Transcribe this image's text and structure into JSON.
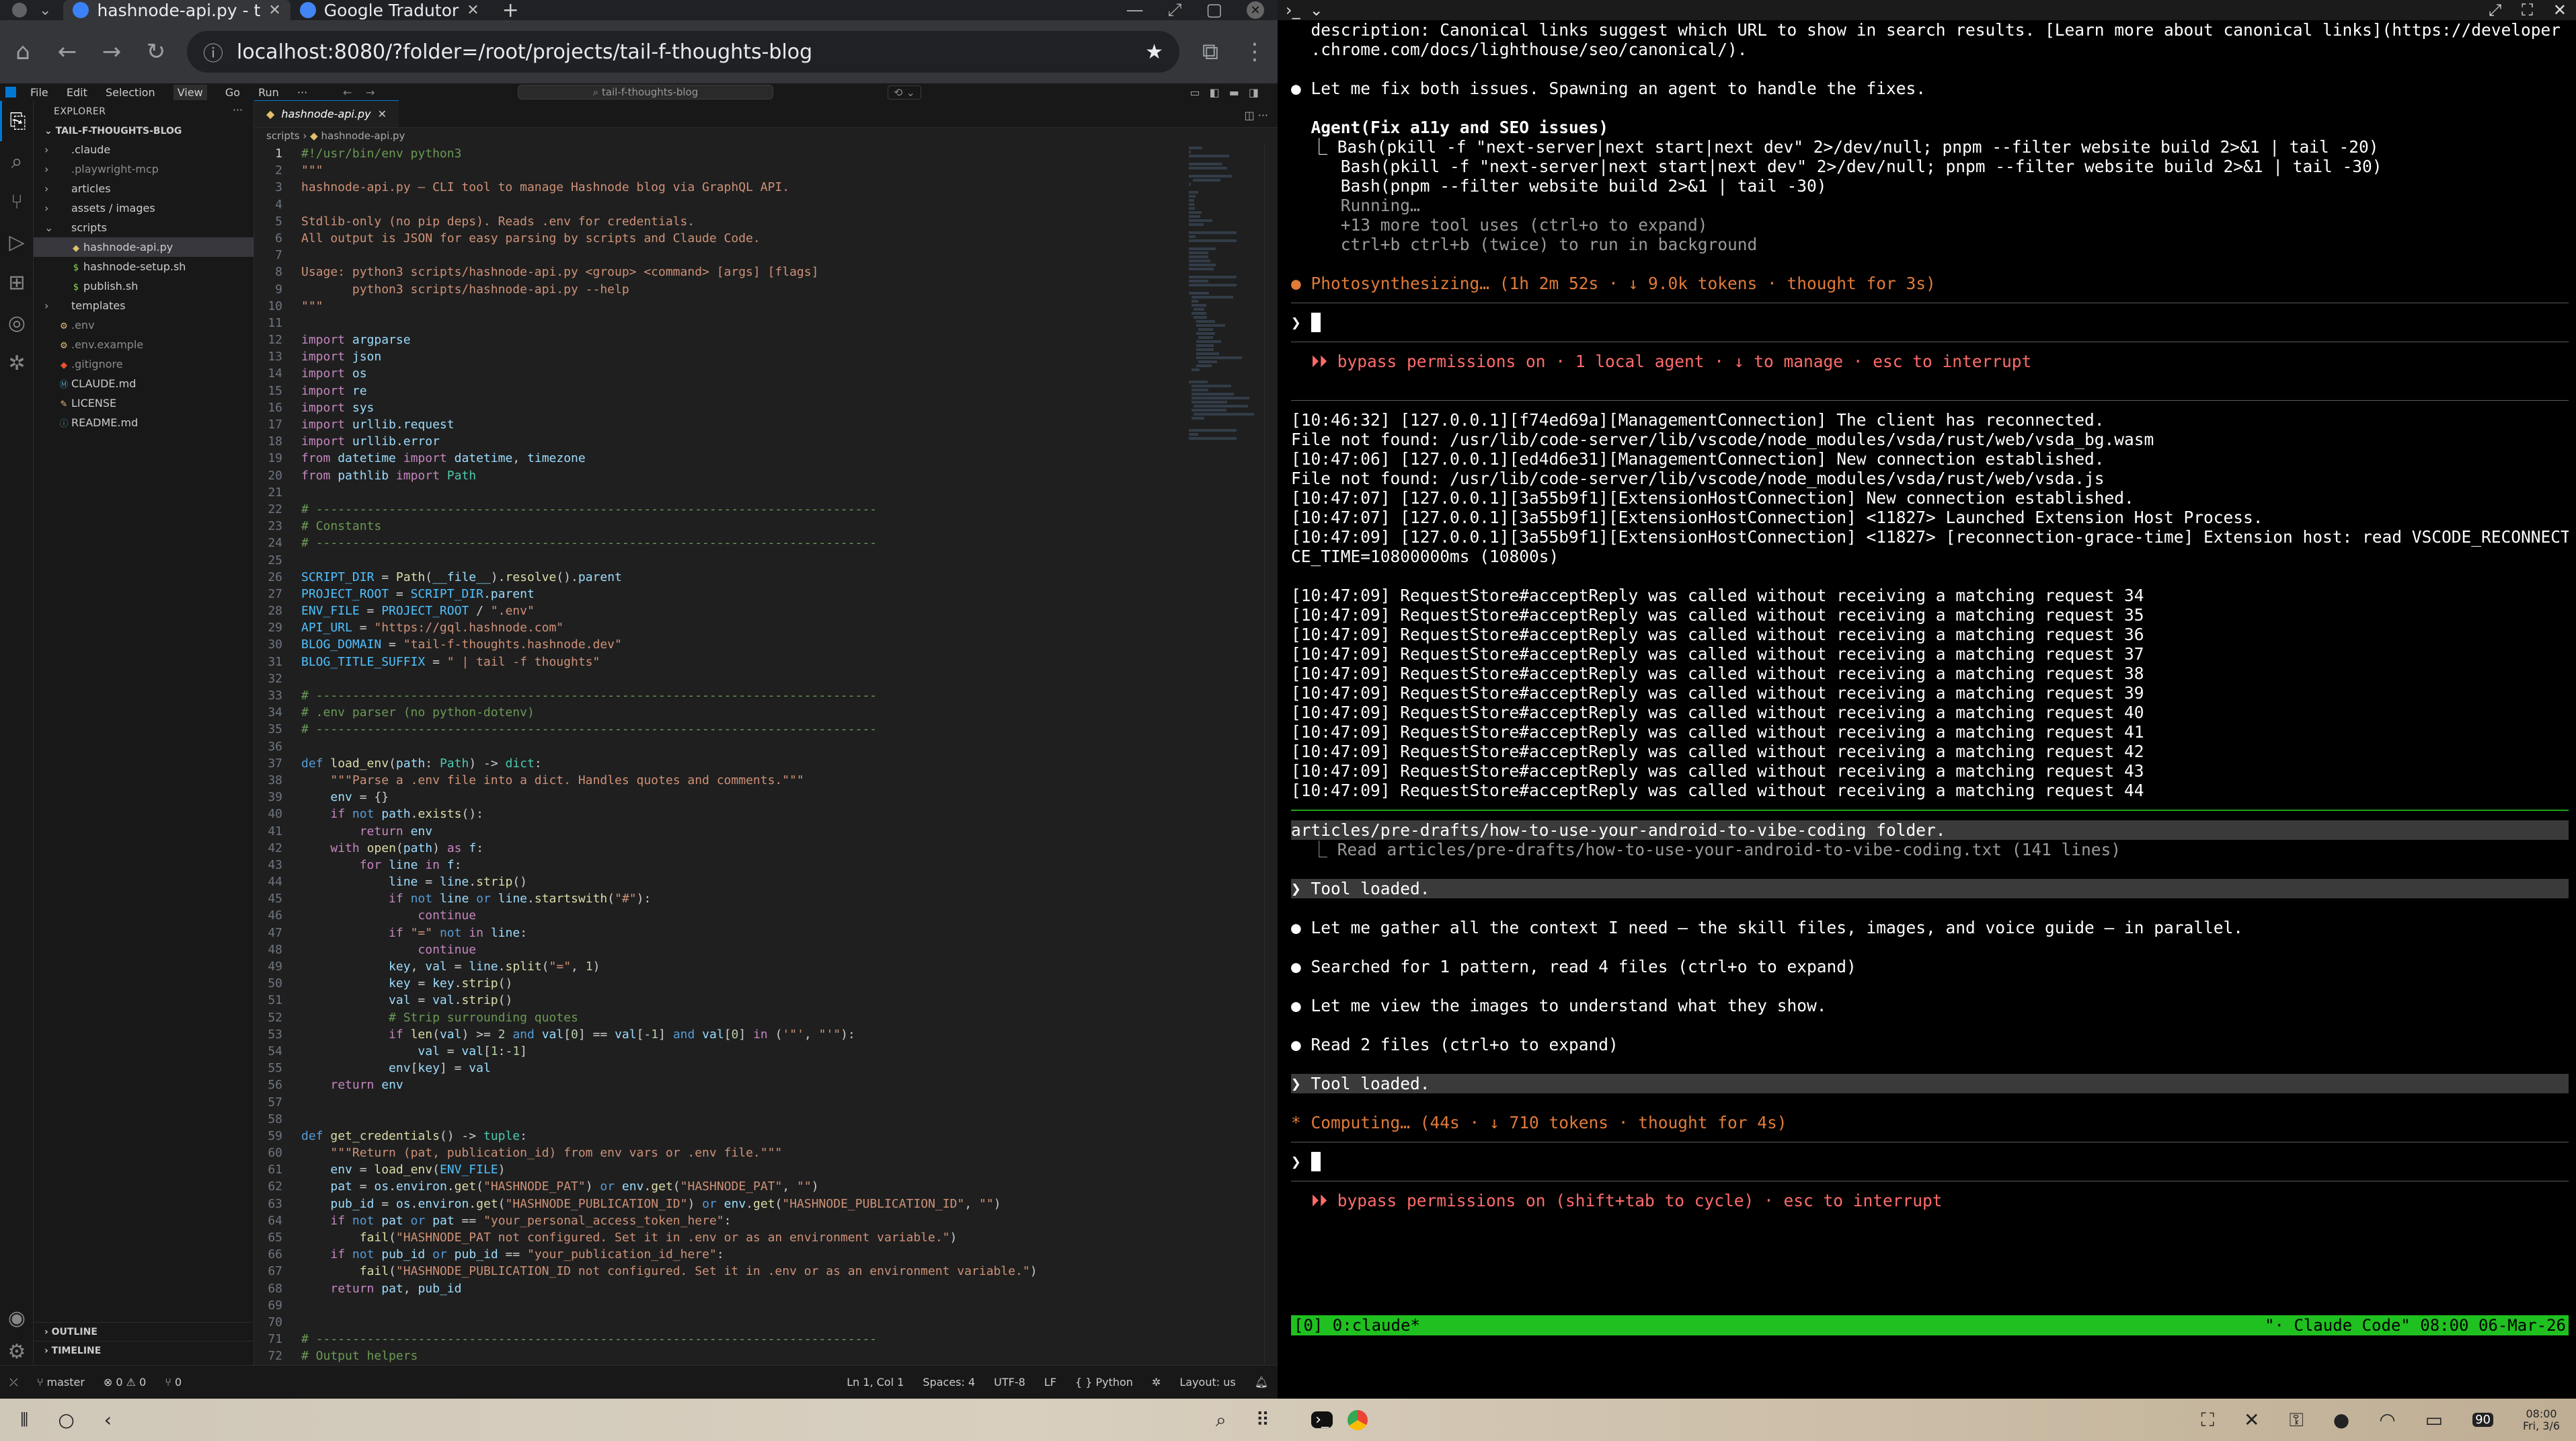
{
  "browser": {
    "tabs": [
      {
        "label": "hashnode-api.py - t",
        "active": true
      },
      {
        "label": "Google Tradutor",
        "active": false
      }
    ],
    "new_tab": "+",
    "url": "localhost:8080/?folder=/root/projects/tail-f-thoughts-blog"
  },
  "vscode": {
    "menu": [
      "File",
      "Edit",
      "Selection",
      "View",
      "Go",
      "Run",
      "···"
    ],
    "search": "tail-f-thoughts-blog",
    "explorer": {
      "title": "EXPLORER",
      "root": "TAIL-F-THOUGHTS-BLOG",
      "items": [
        {
          "label": ".claude",
          "type": "folder",
          "level": 1
        },
        {
          "label": ".playwright-mcp",
          "type": "folder",
          "level": 1
        },
        {
          "label": "articles",
          "type": "folder",
          "level": 1
        },
        {
          "label": "assets / images",
          "type": "folder",
          "level": 1
        },
        {
          "label": "scripts",
          "type": "folder-open",
          "level": 1
        },
        {
          "label": "hashnode-api.py",
          "type": "py",
          "level": 2,
          "selected": true
        },
        {
          "label": "hashnode-setup.sh",
          "type": "sh",
          "level": 2
        },
        {
          "label": "publish.sh",
          "type": "sh",
          "level": 2
        },
        {
          "label": "templates",
          "type": "folder",
          "level": 1
        },
        {
          "label": ".env",
          "type": "env",
          "level": 1
        },
        {
          "label": ".env.example",
          "type": "env",
          "level": 1
        },
        {
          "label": ".gitignore",
          "type": "git",
          "level": 1
        },
        {
          "label": "CLAUDE.md",
          "type": "md",
          "level": 1
        },
        {
          "label": "LICENSE",
          "type": "lic",
          "level": 1
        },
        {
          "label": "README.md",
          "type": "info",
          "level": 1
        }
      ],
      "outline": "OUTLINE",
      "timeline": "TIMELINE"
    },
    "editor_tab": "hashnode-api.py",
    "breadcrumb": [
      "scripts",
      "hashnode-api.py"
    ],
    "code_lines": [
      "#!/usr/bin/env python3",
      "\"\"\"",
      "hashnode-api.py — CLI tool to manage Hashnode blog via GraphQL API.",
      "",
      "Stdlib-only (no pip deps). Reads .env for credentials.",
      "All output is JSON for easy parsing by scripts and Claude Code.",
      "",
      "Usage: python3 scripts/hashnode-api.py <group> <command> [args] [flags]",
      "       python3 scripts/hashnode-api.py --help",
      "\"\"\"",
      "",
      "import argparse",
      "import json",
      "import os",
      "import re",
      "import sys",
      "import urllib.request",
      "import urllib.error",
      "from datetime import datetime, timezone",
      "from pathlib import Path",
      "",
      "# -----------------------------------------------------------------------------",
      "# Constants",
      "# -----------------------------------------------------------------------------",
      "",
      "SCRIPT_DIR = Path(__file__).resolve().parent",
      "PROJECT_ROOT = SCRIPT_DIR.parent",
      "ENV_FILE = PROJECT_ROOT / \".env\"",
      "API_URL = \"https://gql.hashnode.com\"",
      "BLOG_DOMAIN = \"tail-f-thoughts.hashnode.dev\"",
      "BLOG_TITLE_SUFFIX = \" | tail -f thoughts\"",
      "",
      "# -----------------------------------------------------------------------------",
      "# .env parser (no python-dotenv)",
      "# -----------------------------------------------------------------------------",
      "",
      "def load_env(path: Path) -> dict:",
      "    \"\"\"Parse a .env file into a dict. Handles quotes and comments.\"\"\"",
      "    env = {}",
      "    if not path.exists():",
      "        return env",
      "    with open(path) as f:",
      "        for line in f:",
      "            line = line.strip()",
      "            if not line or line.startswith(\"#\"):",
      "                continue",
      "            if \"=\" not in line:",
      "                continue",
      "            key, val = line.split(\"=\", 1)",
      "            key = key.strip()",
      "            val = val.strip()",
      "            # Strip surrounding quotes",
      "            if len(val) >= 2 and val[0] == val[-1] and val[0] in ('\"', \"'\"):",
      "                val = val[1:-1]",
      "            env[key] = val",
      "    return env",
      "",
      "",
      "def get_credentials() -> tuple:",
      "    \"\"\"Return (pat, publication_id) from env vars or .env file.\"\"\"",
      "    env = load_env(ENV_FILE)",
      "    pat = os.environ.get(\"HASHNODE_PAT\") or env.get(\"HASHNODE_PAT\", \"\")",
      "    pub_id = os.environ.get(\"HASHNODE_PUBLICATION_ID\") or env.get(\"HASHNODE_PUBLICATION_ID\", \"\")",
      "    if not pat or pat == \"your_personal_access_token_here\":",
      "        fail(\"HASHNODE_PAT not configured. Set it in .env or as an environment variable.\")",
      "    if not pub_id or pub_id == \"your_publication_id_here\":",
      "        fail(\"HASHNODE_PUBLICATION_ID not configured. Set it in .env or as an environment variable.\")",
      "    return pat, pub_id",
      "",
      "",
      "# -----------------------------------------------------------------------------",
      "# Output helpers",
      "# -----------------------------------------------------------------------------"
    ],
    "status": {
      "branch": "master",
      "errors": "⊗ 0 ⚠ 0",
      "ports": "⑂ 0",
      "position": "Ln 1, Col 1",
      "spaces": "Spaces: 4",
      "encoding": "UTF-8",
      "eol": "LF",
      "language": "{ } Python",
      "layout": "Layout: us"
    }
  },
  "terminal": {
    "claude_top": [
      "  description: Canonical links suggest which URL to show in search results. [Learn more about canonical links](https://developer",
      "  .chrome.com/docs/lighthouse/seo/canonical/).",
      "",
      "● Let me fix both issues. Spawning an agent to handle the fixes.",
      "",
      "  Agent(Fix a11y and SEO issues)",
      "  ⎿ Bash(pkill -f \"next-server|next start|next dev\" 2>/dev/null; pnpm --filter website build 2>&1 | tail -20)",
      "     Bash(pkill -f \"next-server|next start|next dev\" 2>/dev/null; pnpm --filter website build 2>&1 | tail -30)",
      "     Bash(pnpm --filter website build 2>&1 | tail -30)",
      "     Running…",
      "     +13 more tool uses (ctrl+o to expand)",
      "     ctrl+b ctrl+b (twice) to run in background",
      "",
      "● Photosynthesizing… (1h 2m 52s · ↓ 9.0k tokens · thought for 3s)"
    ],
    "prompt_1": "❯ ",
    "mode_1": "  ⏵⏵ bypass permissions on · 1 local agent · ↓ to manage · esc to interrupt",
    "server_log": [
      "[10:46:32] [127.0.0.1][f74ed69a][ManagementConnection] The client has reconnected.",
      "File not found: /usr/lib/code-server/lib/vscode/node_modules/vsda/rust/web/vsda_bg.wasm",
      "[10:47:06] [127.0.0.1][ed4d6e31][ManagementConnection] New connection established.",
      "File not found: /usr/lib/code-server/lib/vscode/node_modules/vsda/rust/web/vsda.js",
      "[10:47:07] [127.0.0.1][3a55b9f1][ExtensionHostConnection] New connection established.",
      "[10:47:07] [127.0.0.1][3a55b9f1][ExtensionHostConnection] <11827> Launched Extension Host Process.",
      "[10:47:09] [127.0.0.1][3a55b9f1][ExtensionHostConnection] <11827> [reconnection-grace-time] Extension host: read VSCODE_RECONNECTION_GRA",
      "CE_TIME=10800000ms (10800s)",
      "",
      "[10:47:09] RequestStore#acceptReply was called without receiving a matching request 34",
      "[10:47:09] RequestStore#acceptReply was called without receiving a matching request 35",
      "[10:47:09] RequestStore#acceptReply was called without receiving a matching request 36",
      "[10:47:09] RequestStore#acceptReply was called without receiving a matching request 37",
      "[10:47:09] RequestStore#acceptReply was called without receiving a matching request 38",
      "[10:47:09] RequestStore#acceptReply was called without receiving a matching request 39",
      "[10:47:09] RequestStore#acceptReply was called without receiving a matching request 40",
      "[10:47:09] RequestStore#acceptReply was called without receiving a matching request 41",
      "[10:47:09] RequestStore#acceptReply was called without receiving a matching request 42",
      "[10:47:09] RequestStore#acceptReply was called without receiving a matching request 43",
      "[10:47:09] RequestStore#acceptReply was called without receiving a matching request 44"
    ],
    "claude_bottom": [
      "articles/pre-drafts/how-to-use-your-android-to-vibe-coding folder.",
      "  ⎿ Read articles/pre-drafts/how-to-use-your-android-to-vibe-coding.txt (141 lines)",
      "",
      "❯ Tool loaded.",
      "",
      "● Let me gather all the context I need — the skill files, images, and voice guide — in parallel.",
      "",
      "● Searched for 1 pattern, read 4 files (ctrl+o to expand)",
      "",
      "● Let me view the images to understand what they show.",
      "",
      "● Read 2 files (ctrl+o to expand)",
      "",
      "❯ Tool loaded.",
      "",
      "* Computing… (44s · ↓ 710 tokens · thought for 4s)"
    ],
    "prompt_2": "❯ ",
    "mode_2": "  ⏵⏵ bypass permissions on (shift+tab to cycle) · esc to interrupt",
    "tmux_left": "[0] 0:claude*",
    "tmux_right": "\"· Claude Code\" 08:00 06-Mar-26"
  },
  "taskbar": {
    "time": "08:00",
    "date": "Fri, 3/6",
    "battery": "90"
  },
  "colors": {
    "accent": "#0078d4",
    "tmux": "#1fc01f"
  }
}
